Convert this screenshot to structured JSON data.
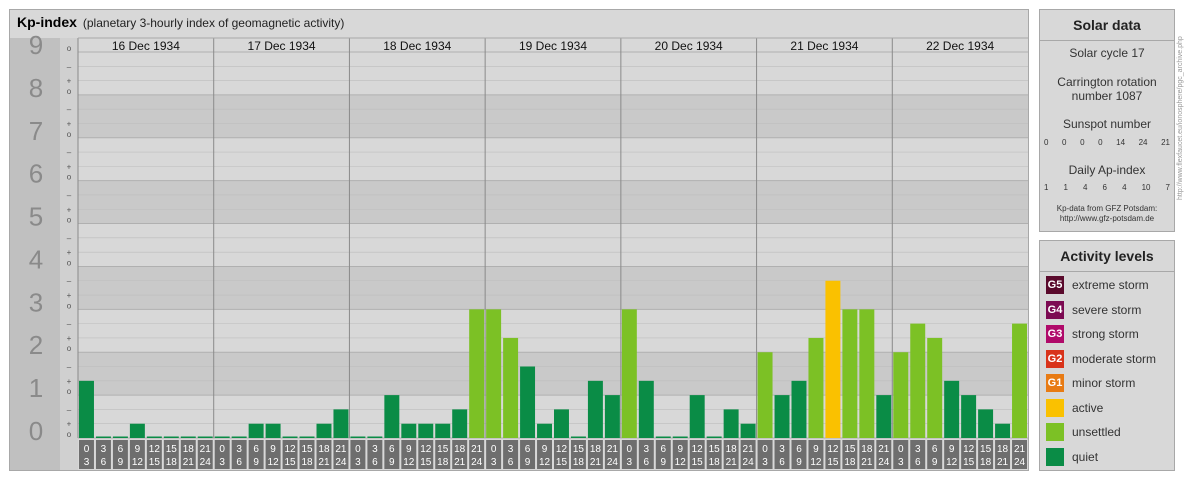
{
  "header": {
    "title": "Kp-index",
    "subtitle": "(planetary 3-hourly index of geomagnetic activity)"
  },
  "chart_data": {
    "type": "bar",
    "title": "Kp-index",
    "subtitle": "(planetary 3-hourly index of geomagnetic activity)",
    "ylim": [
      0,
      9
    ],
    "y_ticks": [
      "0",
      "1",
      "2",
      "3",
      "4",
      "5",
      "6",
      "7",
      "8",
      "9"
    ],
    "minor_ticks": [
      "o",
      "+",
      "–"
    ],
    "days": [
      "16 Dec 1934",
      "17 Dec 1934",
      "18 Dec 1934",
      "19 Dec 1934",
      "20 Dec 1934",
      "21 Dec 1934",
      "22 Dec 1934"
    ],
    "interval_start": [
      "0",
      "3",
      "6",
      "9",
      "12",
      "15",
      "18",
      "21"
    ],
    "interval_end": [
      "3",
      "6",
      "9",
      "12",
      "15",
      "18",
      "21",
      "24"
    ],
    "values": [
      [
        1.333,
        0,
        0,
        0.333,
        0,
        0,
        0,
        0
      ],
      [
        0,
        0,
        0.333,
        0.333,
        0,
        0,
        0.333,
        0.667
      ],
      [
        0,
        0,
        1,
        0.333,
        0.333,
        0.333,
        0.667,
        3
      ],
      [
        3,
        2.333,
        1.667,
        0.333,
        0.667,
        0,
        1.333,
        1
      ],
      [
        3,
        1.333,
        0,
        0,
        1,
        0,
        0.667,
        0.333
      ],
      [
        2,
        1,
        1.333,
        2.333,
        3.667,
        3,
        3,
        1
      ],
      [
        2,
        2.667,
        2.333,
        1.333,
        1,
        0.667,
        0.333,
        2.667
      ]
    ],
    "colors": {
      "quiet": "#0a8c46",
      "unsettled": "#7cc125",
      "active": "#fac100"
    }
  },
  "solar": {
    "title": "Solar data",
    "cycle": "Solar cycle 17",
    "rotation_l1": "Carrington rotation",
    "rotation_l2": "number 1087",
    "sunspot_label": "Sunspot number",
    "sunspot_values": [
      "0",
      "0",
      "0",
      "0",
      "14",
      "24",
      "21"
    ],
    "ap_label": "Daily Ap-index",
    "ap_values": [
      "1",
      "1",
      "4",
      "6",
      "4",
      "10",
      "7"
    ],
    "credit_l1": "Kp-data from GFZ Potsdam:",
    "credit_l2": "http://www.gfz-potsdam.de"
  },
  "levels": {
    "title": "Activity levels",
    "items": [
      {
        "code": "G5",
        "label": "extreme storm",
        "color": "#5a0a2c"
      },
      {
        "code": "G4",
        "label": "severe storm",
        "color": "#7c0a52"
      },
      {
        "code": "G3",
        "label": "strong storm",
        "color": "#b00a6a"
      },
      {
        "code": "G2",
        "label": "moderate storm",
        "color": "#d9331a"
      },
      {
        "code": "G1",
        "label": "minor storm",
        "color": "#e87b14"
      },
      {
        "code": "",
        "label": "active",
        "color": "#fac100"
      },
      {
        "code": "",
        "label": "unsettled",
        "color": "#7cc125"
      },
      {
        "code": "",
        "label": "quiet",
        "color": "#0a8c46"
      }
    ]
  },
  "side_url": "http://www.flexfaucet.eu/ionosphere/pgc_archive.php"
}
